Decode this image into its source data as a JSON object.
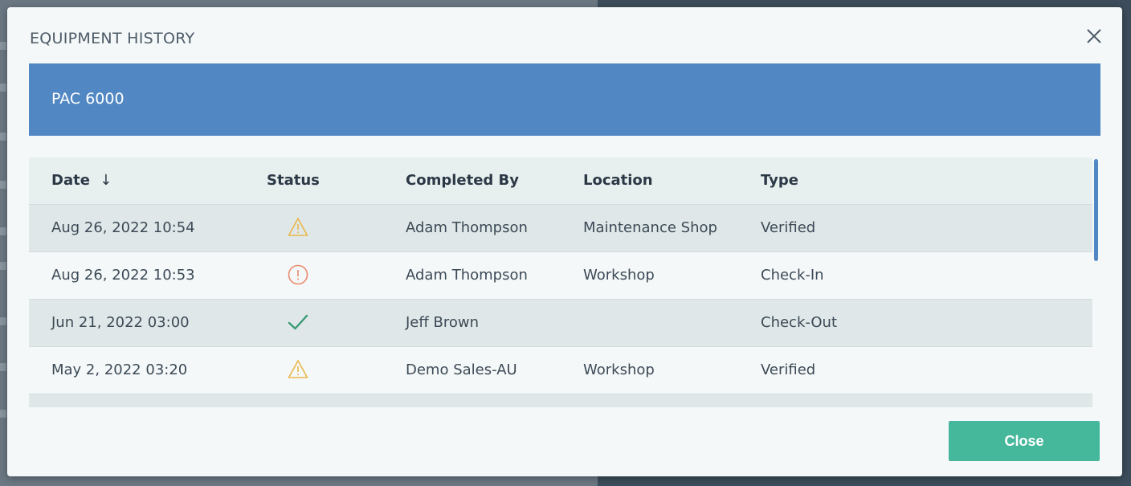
{
  "modal": {
    "title": "EQUIPMENT HISTORY",
    "equipment_name": "PAC 6000",
    "close_button_label": "Close"
  },
  "table": {
    "columns": [
      {
        "label": "Date",
        "sort": "descending"
      },
      {
        "label": "Status"
      },
      {
        "label": "Completed By"
      },
      {
        "label": "Location"
      },
      {
        "label": "Type"
      }
    ],
    "sort_indicator": "↓",
    "rows": [
      {
        "date": "Aug 26, 2022 10:54",
        "status": "warning",
        "completed_by": "Adam Thompson",
        "location": "Maintenance Shop",
        "type": "Verified"
      },
      {
        "date": "Aug 26, 2022 10:53",
        "status": "alert",
        "completed_by": "Adam Thompson",
        "location": "Workshop",
        "type": "Check-In"
      },
      {
        "date": "Jun 21, 2022 03:00",
        "status": "ok",
        "completed_by": "Jeff Brown",
        "location": "",
        "type": "Check-Out"
      },
      {
        "date": "May 2, 2022 03:20",
        "status": "warning",
        "completed_by": "Demo Sales-AU",
        "location": "Workshop",
        "type": "Verified"
      }
    ]
  },
  "icons": {
    "close": "close-icon",
    "warning": "warning-triangle-icon",
    "alert": "alert-circle-icon",
    "ok": "checkmark-icon"
  },
  "colors": {
    "banner": "#5187c3",
    "primary_button": "#45b79a",
    "warning": "#e8b84a",
    "alert": "#e98a6e",
    "ok": "#3a9a74"
  }
}
